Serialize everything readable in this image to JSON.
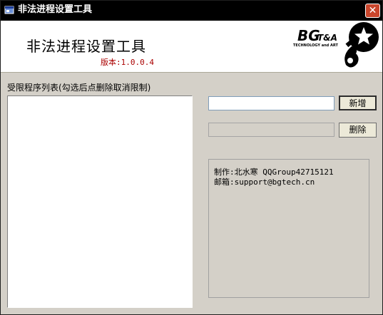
{
  "window": {
    "title": "非法进程设置工具",
    "close_glyph": "✕"
  },
  "header": {
    "title": "非法进程设置工具",
    "version": "版本:1.0.0.4",
    "logo": {
      "main": "BG",
      "suffix": "T&A",
      "tagline": "TECHNOLOGY and ART"
    }
  },
  "list_panel": {
    "label": "受限程序列表(勾选后点删除取消限制)",
    "items": []
  },
  "controls": {
    "input_value": "",
    "add_button": "新增",
    "delete_button": "删除"
  },
  "info": {
    "line1": "制作:北水寒 QQGroup42715121",
    "line2": "邮箱:support@bgtech.cn"
  },
  "icons": {
    "app": "app-window-icon",
    "close": "close-icon",
    "logo": "bg-star-logo-icon"
  },
  "colors": {
    "titlebar": "#000000",
    "close_button": "#c9462c",
    "version_text": "#aa0000",
    "window_bg": "#d4d0c8"
  }
}
